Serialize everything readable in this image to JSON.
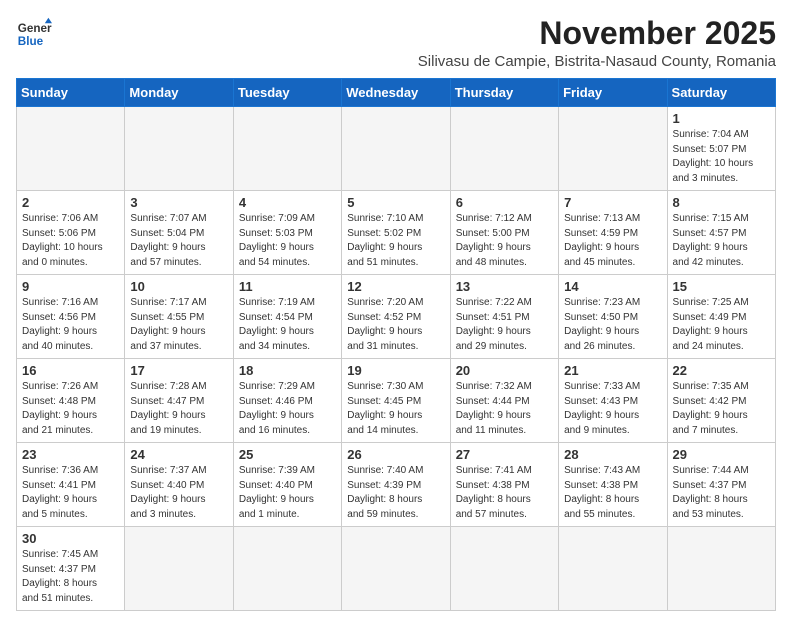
{
  "logo": {
    "line1": "General",
    "line2": "Blue"
  },
  "title": "November 2025",
  "subtitle": "Silivasu de Campie, Bistrita-Nasaud County, Romania",
  "days_header": [
    "Sunday",
    "Monday",
    "Tuesday",
    "Wednesday",
    "Thursday",
    "Friday",
    "Saturday"
  ],
  "weeks": [
    [
      {
        "day": "",
        "info": ""
      },
      {
        "day": "",
        "info": ""
      },
      {
        "day": "",
        "info": ""
      },
      {
        "day": "",
        "info": ""
      },
      {
        "day": "",
        "info": ""
      },
      {
        "day": "",
        "info": ""
      },
      {
        "day": "1",
        "info": "Sunrise: 7:04 AM\nSunset: 5:07 PM\nDaylight: 10 hours\nand 3 minutes."
      }
    ],
    [
      {
        "day": "2",
        "info": "Sunrise: 7:06 AM\nSunset: 5:06 PM\nDaylight: 10 hours\nand 0 minutes."
      },
      {
        "day": "3",
        "info": "Sunrise: 7:07 AM\nSunset: 5:04 PM\nDaylight: 9 hours\nand 57 minutes."
      },
      {
        "day": "4",
        "info": "Sunrise: 7:09 AM\nSunset: 5:03 PM\nDaylight: 9 hours\nand 54 minutes."
      },
      {
        "day": "5",
        "info": "Sunrise: 7:10 AM\nSunset: 5:02 PM\nDaylight: 9 hours\nand 51 minutes."
      },
      {
        "day": "6",
        "info": "Sunrise: 7:12 AM\nSunset: 5:00 PM\nDaylight: 9 hours\nand 48 minutes."
      },
      {
        "day": "7",
        "info": "Sunrise: 7:13 AM\nSunset: 4:59 PM\nDaylight: 9 hours\nand 45 minutes."
      },
      {
        "day": "8",
        "info": "Sunrise: 7:15 AM\nSunset: 4:57 PM\nDaylight: 9 hours\nand 42 minutes."
      }
    ],
    [
      {
        "day": "9",
        "info": "Sunrise: 7:16 AM\nSunset: 4:56 PM\nDaylight: 9 hours\nand 40 minutes."
      },
      {
        "day": "10",
        "info": "Sunrise: 7:17 AM\nSunset: 4:55 PM\nDaylight: 9 hours\nand 37 minutes."
      },
      {
        "day": "11",
        "info": "Sunrise: 7:19 AM\nSunset: 4:54 PM\nDaylight: 9 hours\nand 34 minutes."
      },
      {
        "day": "12",
        "info": "Sunrise: 7:20 AM\nSunset: 4:52 PM\nDaylight: 9 hours\nand 31 minutes."
      },
      {
        "day": "13",
        "info": "Sunrise: 7:22 AM\nSunset: 4:51 PM\nDaylight: 9 hours\nand 29 minutes."
      },
      {
        "day": "14",
        "info": "Sunrise: 7:23 AM\nSunset: 4:50 PM\nDaylight: 9 hours\nand 26 minutes."
      },
      {
        "day": "15",
        "info": "Sunrise: 7:25 AM\nSunset: 4:49 PM\nDaylight: 9 hours\nand 24 minutes."
      }
    ],
    [
      {
        "day": "16",
        "info": "Sunrise: 7:26 AM\nSunset: 4:48 PM\nDaylight: 9 hours\nand 21 minutes."
      },
      {
        "day": "17",
        "info": "Sunrise: 7:28 AM\nSunset: 4:47 PM\nDaylight: 9 hours\nand 19 minutes."
      },
      {
        "day": "18",
        "info": "Sunrise: 7:29 AM\nSunset: 4:46 PM\nDaylight: 9 hours\nand 16 minutes."
      },
      {
        "day": "19",
        "info": "Sunrise: 7:30 AM\nSunset: 4:45 PM\nDaylight: 9 hours\nand 14 minutes."
      },
      {
        "day": "20",
        "info": "Sunrise: 7:32 AM\nSunset: 4:44 PM\nDaylight: 9 hours\nand 11 minutes."
      },
      {
        "day": "21",
        "info": "Sunrise: 7:33 AM\nSunset: 4:43 PM\nDaylight: 9 hours\nand 9 minutes."
      },
      {
        "day": "22",
        "info": "Sunrise: 7:35 AM\nSunset: 4:42 PM\nDaylight: 9 hours\nand 7 minutes."
      }
    ],
    [
      {
        "day": "23",
        "info": "Sunrise: 7:36 AM\nSunset: 4:41 PM\nDaylight: 9 hours\nand 5 minutes."
      },
      {
        "day": "24",
        "info": "Sunrise: 7:37 AM\nSunset: 4:40 PM\nDaylight: 9 hours\nand 3 minutes."
      },
      {
        "day": "25",
        "info": "Sunrise: 7:39 AM\nSunset: 4:40 PM\nDaylight: 9 hours\nand 1 minute."
      },
      {
        "day": "26",
        "info": "Sunrise: 7:40 AM\nSunset: 4:39 PM\nDaylight: 8 hours\nand 59 minutes."
      },
      {
        "day": "27",
        "info": "Sunrise: 7:41 AM\nSunset: 4:38 PM\nDaylight: 8 hours\nand 57 minutes."
      },
      {
        "day": "28",
        "info": "Sunrise: 7:43 AM\nSunset: 4:38 PM\nDaylight: 8 hours\nand 55 minutes."
      },
      {
        "day": "29",
        "info": "Sunrise: 7:44 AM\nSunset: 4:37 PM\nDaylight: 8 hours\nand 53 minutes."
      }
    ],
    [
      {
        "day": "30",
        "info": "Sunrise: 7:45 AM\nSunset: 4:37 PM\nDaylight: 8 hours\nand 51 minutes."
      },
      {
        "day": "",
        "info": ""
      },
      {
        "day": "",
        "info": ""
      },
      {
        "day": "",
        "info": ""
      },
      {
        "day": "",
        "info": ""
      },
      {
        "day": "",
        "info": ""
      },
      {
        "day": "",
        "info": ""
      }
    ]
  ]
}
